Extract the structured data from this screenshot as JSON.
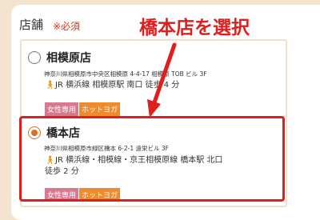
{
  "form": {
    "field_label": "店舗",
    "required_label": "※必須"
  },
  "stores": [
    {
      "name": "相模原店",
      "address": "神奈川県相模原市中央区相模原 4-4-17 相模原 TOB ビル 3F",
      "access": "JR 横浜線 相模原駅 南口 徒歩 4 分",
      "tags": [
        "女性専用",
        "ホットヨガ"
      ],
      "selected": false
    },
    {
      "name": "橋本店",
      "address": "神奈川県相模原市緑区橋本 6-2-1 遠栄ビル 3F",
      "access": "JR 横浜線・相模線・京王相模原線 橋本駅 北口 徒歩 2 分",
      "tags": [
        "女性専用",
        "ホットヨガ"
      ],
      "selected": true
    }
  ],
  "annotation": {
    "callout": "橋本店を選択",
    "color": "#e21d1d"
  },
  "colors": {
    "accent_orange": "#e26b2a",
    "tag_women": "#d9798f",
    "tag_hotyoga": "#ee8b2e",
    "required": "#e0301e",
    "background": "#f3e3cf"
  },
  "icons": {
    "walk": "walking-person-icon"
  }
}
